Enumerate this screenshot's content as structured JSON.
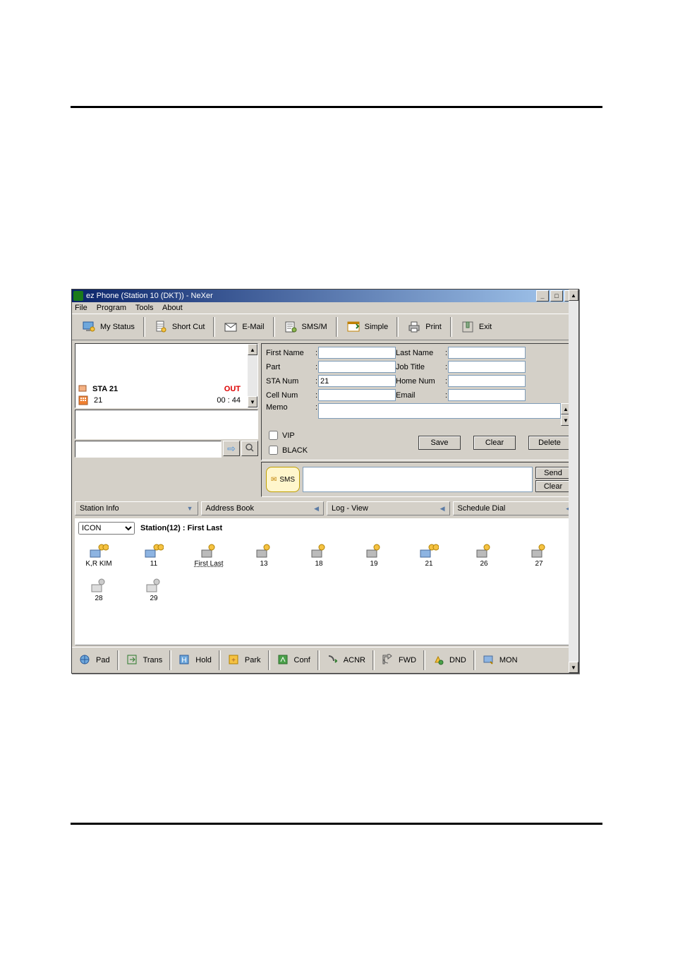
{
  "window": {
    "title": "ez Phone (Station 10 (DKT)) - NeXer"
  },
  "menu": {
    "file": "File",
    "program": "Program",
    "tools": "Tools",
    "about": "About"
  },
  "toolbar": {
    "my_status": "My Status",
    "short_cut": "Short Cut",
    "email": "E-Mail",
    "smsm": "SMS/M",
    "simple": "Simple",
    "print": "Print",
    "exit": "Exit"
  },
  "call": {
    "station_label": "STA 21",
    "station_sub": "21",
    "status": "OUT",
    "time": "00 : 44"
  },
  "form": {
    "first_name_lbl": "First Name",
    "last_name_lbl": "Last Name",
    "part_lbl": "Part",
    "job_lbl": "Job Title",
    "sta_lbl": "STA Num",
    "sta_val": "21",
    "home_lbl": "Home Num",
    "cell_lbl": "Cell Num",
    "email_lbl": "Email",
    "memo_lbl": "Memo",
    "vip": "VIP",
    "black": "BLACK",
    "save": "Save",
    "clear": "Clear",
    "delete": "Delete"
  },
  "sms": {
    "badge": "SMS",
    "send": "Send",
    "clear": "Clear"
  },
  "tabs": {
    "station_info": "Station Info",
    "address_book": "Address Book",
    "log_view": "Log - View",
    "schedule": "Schedule Dial"
  },
  "station_panel": {
    "dropdown": "ICON",
    "header": "Station(12) :  First Last",
    "items": [
      {
        "label": "K,R KIM"
      },
      {
        "label": "11"
      },
      {
        "label": "First Last"
      },
      {
        "label": "13"
      },
      {
        "label": "18"
      },
      {
        "label": "19"
      },
      {
        "label": "21"
      },
      {
        "label": "26"
      },
      {
        "label": "27"
      },
      {
        "label": "28"
      },
      {
        "label": "29"
      }
    ]
  },
  "bottom": {
    "pad": "Pad",
    "trans": "Trans",
    "hold": "Hold",
    "park": "Park",
    "conf": "Conf",
    "acnr": "ACNR",
    "fwd": "FWD",
    "dnd": "DND",
    "mon": "MON"
  }
}
